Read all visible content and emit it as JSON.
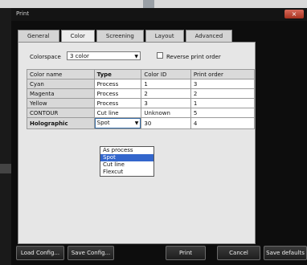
{
  "window": {
    "title": "Print",
    "close_glyph": "×"
  },
  "tabs": [
    {
      "label": "General",
      "active": false
    },
    {
      "label": "Color",
      "active": true
    },
    {
      "label": "Screening",
      "active": false
    },
    {
      "label": "Layout",
      "active": false
    },
    {
      "label": "Advanced",
      "active": false
    }
  ],
  "colorspace": {
    "label": "Colorspace",
    "value": "3 color"
  },
  "reverse_print_order": {
    "label": "Reverse print order",
    "checked": false
  },
  "table": {
    "headers": [
      "Color name",
      "Type",
      "Color ID",
      "Print order"
    ],
    "rows": [
      {
        "name": "Cyan",
        "type": "Process",
        "color_id": "1",
        "print_order": "3"
      },
      {
        "name": "Magenta",
        "type": "Process",
        "color_id": "2",
        "print_order": "2"
      },
      {
        "name": "Yellow",
        "type": "Process",
        "color_id": "3",
        "print_order": "1"
      },
      {
        "name": "CONTOUR",
        "type": "Cut line",
        "color_id": "Unknown",
        "print_order": "5"
      },
      {
        "name": "Holographic",
        "type": "Spot",
        "color_id": "30",
        "print_order": "4"
      }
    ]
  },
  "type_dropdown": {
    "options": [
      "As process",
      "Spot",
      "Cut line",
      "Flexcut"
    ],
    "selected": "Spot"
  },
  "buttons": {
    "load_config": "Load Config...",
    "save_config": "Save Config...",
    "print": "Print",
    "cancel": "Cancel",
    "save_defaults": "Save defaults"
  },
  "colors": {
    "selection": "#3366cc",
    "close_button": "#c0452f"
  }
}
